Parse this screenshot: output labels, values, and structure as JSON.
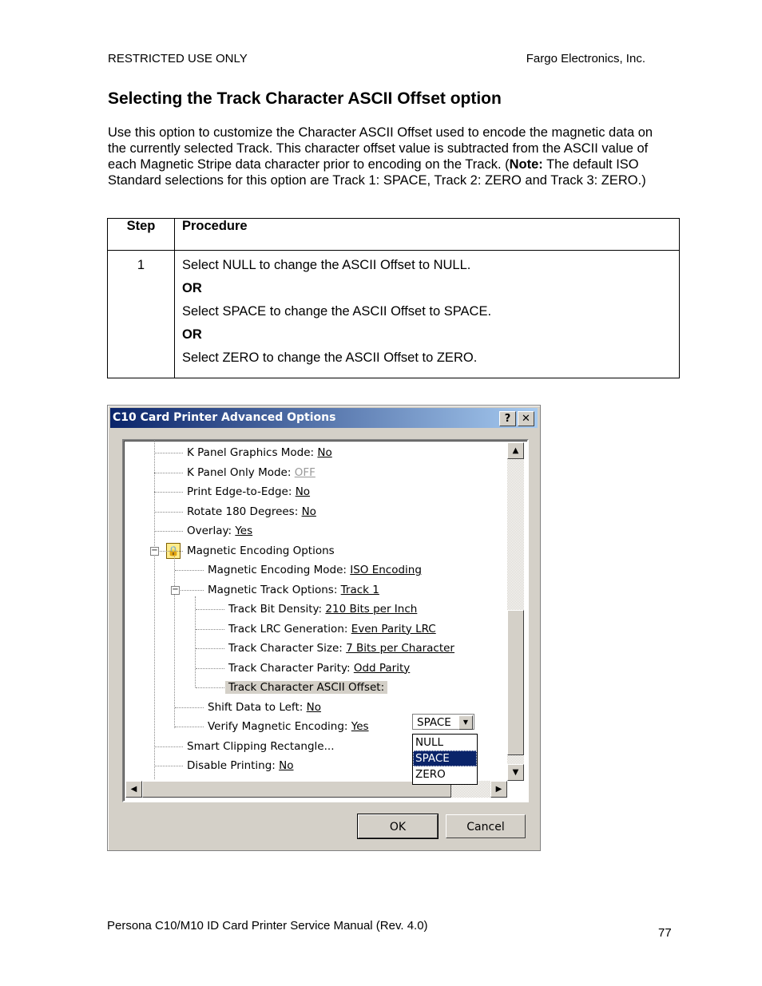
{
  "header": {
    "left": "RESTRICTED USE ONLY",
    "right": "Fargo Electronics, Inc."
  },
  "title": "Selecting the Track Character ASCII Offset option",
  "intro": {
    "text_before_note": "Use this option to customize the Character ASCII Offset used to encode the magnetic data on the currently selected Track. This character offset value is subtracted from the ASCII value of each Magnetic Stripe data character prior to encoding on the Track. (",
    "note_label": "Note:",
    "text_after_note": "  The default ISO Standard selections for this option are Track 1: SPACE, Track 2: ZERO and Track 3: ZERO.)"
  },
  "table": {
    "headers": [
      "Step",
      "Procedure"
    ],
    "rows": [
      {
        "step": "1",
        "lines": [
          {
            "text": "Select NULL to change the ASCII Offset to NULL.",
            "bold": false
          },
          {
            "text": "OR",
            "bold": true
          },
          {
            "text": "Select SPACE to change the ASCII Offset to SPACE.",
            "bold": false
          },
          {
            "text": "OR",
            "bold": true
          },
          {
            "text": "Select ZERO to change the ASCII Offset to ZERO.",
            "bold": false
          }
        ]
      }
    ]
  },
  "dialog": {
    "title": "C10 Card Printer Advanced Options",
    "help_label": "?",
    "close_label": "✕",
    "tree": [
      {
        "level": 0,
        "label": "K Panel Graphics Mode: ",
        "value": "No"
      },
      {
        "level": 0,
        "label": "K Panel Only Mode: ",
        "value": "OFF",
        "disabled": true
      },
      {
        "level": 0,
        "label": "Print Edge-to-Edge: ",
        "value": "No"
      },
      {
        "level": 0,
        "label": "Rotate 180 Degrees: ",
        "value": "No"
      },
      {
        "level": 0,
        "label": "Overlay: ",
        "value": "Yes"
      },
      {
        "level": 0,
        "label": "Magnetic Encoding Options",
        "value": "",
        "expander": "−",
        "icon": "lock-folder-icon"
      },
      {
        "level": 1,
        "label": "Magnetic Encoding Mode: ",
        "value": "ISO Encoding"
      },
      {
        "level": 1,
        "label": "Magnetic Track Options: ",
        "value": "Track 1",
        "expander": "−"
      },
      {
        "level": 2,
        "label": "Track Bit Density: ",
        "value": "210 Bits per Inch"
      },
      {
        "level": 2,
        "label": "Track LRC Generation: ",
        "value": "Even Parity LRC"
      },
      {
        "level": 2,
        "label": "Track Character Size: ",
        "value": "7 Bits per Character"
      },
      {
        "level": 2,
        "label": "Track Character Parity: ",
        "value": "Odd Parity"
      },
      {
        "level": 2,
        "label": "Track Character ASCII Offset:",
        "value": "",
        "selected": true
      },
      {
        "level": 1,
        "label": "Shift Data to Left: ",
        "value": "No"
      },
      {
        "level": 1,
        "label": "Verify Magnetic Encoding: ",
        "value": "Yes"
      },
      {
        "level": 0,
        "label": "Smart Clipping Rectangle...",
        "value": ""
      },
      {
        "level": 0,
        "label": "Disable Printing: ",
        "value": "No"
      }
    ],
    "combo": {
      "value": "SPACE",
      "options": [
        "NULL",
        "SPACE",
        "ZERO"
      ],
      "highlighted": "SPACE"
    },
    "ok_label": "OK",
    "cancel_label": "Cancel",
    "colors": {
      "titlebar": "#0a246a",
      "highlight": "#0a246a",
      "face": "#d4d0c8"
    }
  },
  "footer": {
    "manual": "Persona C10/M10 ID Card Printer Service Manual (Rev. 4.0)",
    "page": "77"
  }
}
